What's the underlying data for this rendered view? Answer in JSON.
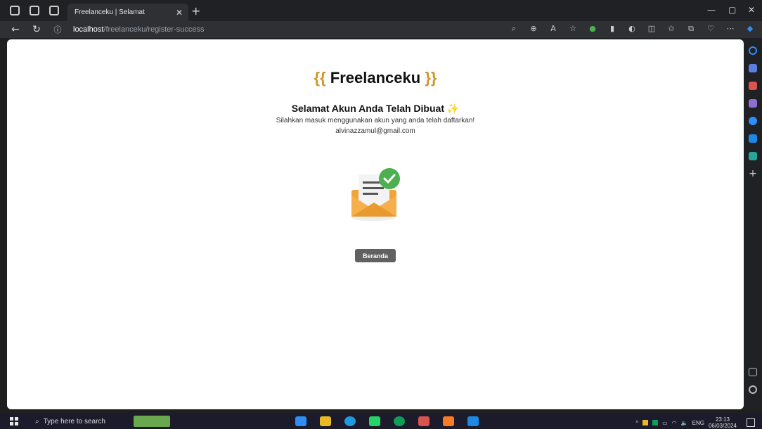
{
  "browser": {
    "tab_title": "Freelanceku | Selamat",
    "url_host": "localhost",
    "url_path": "/freelanceku/register-success"
  },
  "page": {
    "brand_open": "{{",
    "brand_name": "Freelanceku",
    "brand_close": "}}",
    "heading": "Selamat Akun Anda Telah Dibuat",
    "subtitle": "Silahkan masuk menggunakan akun yang anda telah daftarkan!",
    "email": "alvinazzamul@gmail.com",
    "button_label": "Beranda"
  },
  "taskbar": {
    "search_placeholder": "Type here to search",
    "language": "ENG",
    "time": "23:13",
    "date": "06/03/2024"
  },
  "colors": {
    "accent": "#d0952c",
    "button": "#616161",
    "success": "#4caf50",
    "envelope": "#f0a43a"
  }
}
